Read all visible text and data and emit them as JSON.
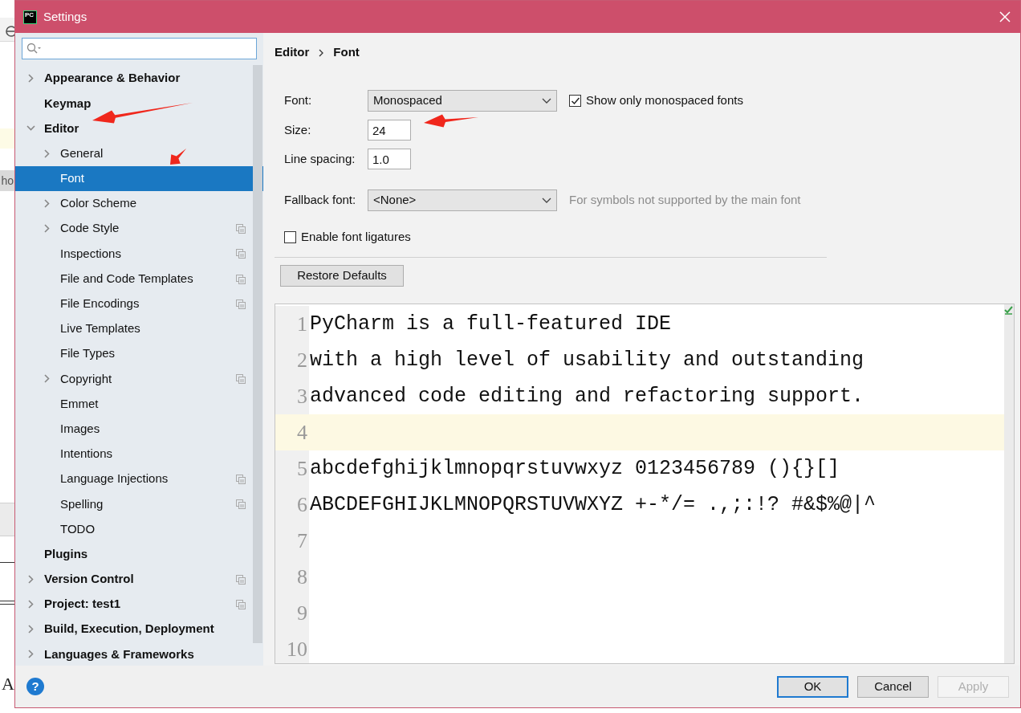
{
  "background_window": {
    "texts": [
      "ho",
      "A"
    ]
  },
  "window": {
    "app_icon_label": "PC",
    "title": "Settings"
  },
  "sidebar": {
    "items": [
      {
        "label": "Appearance & Behavior",
        "expanded": false,
        "selected": false
      },
      {
        "label": "Keymap",
        "selected": false
      },
      {
        "label": "Editor",
        "expanded": true,
        "selected": false,
        "children": [
          {
            "label": "General",
            "expanded": false,
            "selected": false
          },
          {
            "label": "Font",
            "selected": true
          },
          {
            "label": "Color Scheme",
            "expanded": false,
            "selected": false
          },
          {
            "label": "Code Style",
            "expanded": false,
            "selected": false,
            "project_scope": true
          },
          {
            "label": "Inspections",
            "selected": false,
            "project_scope": true
          },
          {
            "label": "File and Code Templates",
            "selected": false,
            "project_scope": true
          },
          {
            "label": "File Encodings",
            "selected": false,
            "project_scope": true
          },
          {
            "label": "Live Templates",
            "selected": false
          },
          {
            "label": "File Types",
            "selected": false
          },
          {
            "label": "Copyright",
            "expanded": false,
            "selected": false,
            "project_scope": true
          },
          {
            "label": "Emmet",
            "selected": false
          },
          {
            "label": "Images",
            "selected": false
          },
          {
            "label": "Intentions",
            "selected": false
          },
          {
            "label": "Language Injections",
            "selected": false,
            "project_scope": true
          },
          {
            "label": "Spelling",
            "selected": false,
            "project_scope": true
          },
          {
            "label": "TODO",
            "selected": false
          }
        ]
      },
      {
        "label": "Plugins",
        "selected": false
      },
      {
        "label": "Version Control",
        "expanded": false,
        "selected": false,
        "project_scope": true
      },
      {
        "label": "Project: test1",
        "expanded": false,
        "selected": false,
        "project_scope": true
      },
      {
        "label": "Build, Execution, Deployment",
        "expanded": false,
        "selected": false
      },
      {
        "label": "Languages & Frameworks",
        "expanded": false,
        "selected": false
      }
    ]
  },
  "breadcrumb": [
    "Editor",
    "Font"
  ],
  "form": {
    "font": {
      "label": "Font:",
      "value": "Monospaced"
    },
    "monospaced_only": {
      "label": "Show only monospaced fonts",
      "checked": true
    },
    "size": {
      "label": "Size:",
      "value": "24"
    },
    "line_spacing": {
      "label": "Line spacing:",
      "value": "1.0"
    },
    "fallback_font": {
      "label": "Fallback font:",
      "value": "<None>",
      "hint": "For symbols not supported by the main font"
    },
    "ligatures": {
      "label": "Enable font ligatures",
      "checked": false
    },
    "restore_button": "Restore Defaults"
  },
  "preview": {
    "lines": [
      {
        "number": "1",
        "text": "PyCharm is a full-featured IDE",
        "current": false
      },
      {
        "number": "2",
        "text": "with a high level of usability and outstanding",
        "current": false
      },
      {
        "number": "3",
        "text": "advanced code editing and refactoring support.",
        "current": false
      },
      {
        "number": "4",
        "current": true
      },
      {
        "number": "5",
        "text": "abcdefghijklmnopqrstuvwxyz 0123456789 (){}[]",
        "current": false
      },
      {
        "number": "6",
        "text": "ABCDEFGHIJKLMNOPQRSTUVWXYZ +-*/= .,;:!? #&$%@|^",
        "current": false
      },
      {
        "number": "7",
        "current": false
      },
      {
        "number": "8",
        "current": false
      },
      {
        "number": "9",
        "current": false
      },
      {
        "number": "10",
        "current": false
      }
    ]
  },
  "footer": {
    "help": "?",
    "buttons": [
      {
        "label": "OK",
        "kind": "default",
        "disabled": false
      },
      {
        "label": "Cancel",
        "kind": "normal",
        "disabled": false
      },
      {
        "label": "Apply",
        "kind": "normal",
        "disabled": true
      }
    ]
  }
}
